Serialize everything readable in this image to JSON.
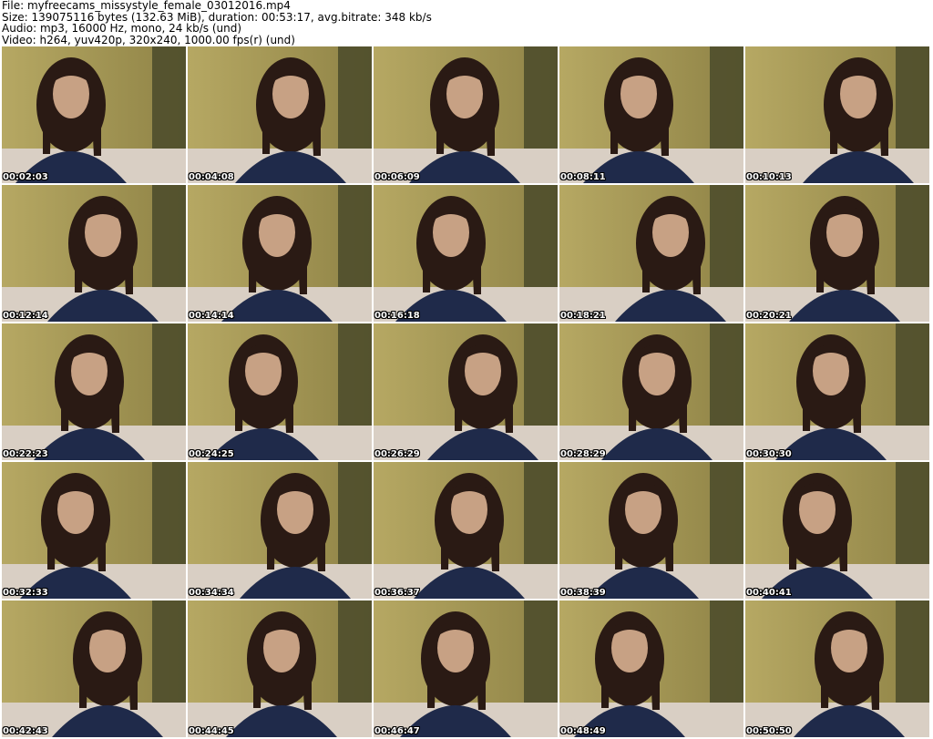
{
  "header": {
    "file_line": "File: myfreecams_missystyle_female_03012016.mp4",
    "size_line": "Size: 139075116 bytes (132.63 MiB), duration: 00:53:17, avg.bitrate: 348 kb/s",
    "audio_line": "Audio: mp3, 16000 Hz, mono, 24 kb/s (und)",
    "video_line": "Video: h264, yuv420p, 320x240, 1000.00 fps(r) (und)"
  },
  "colors": {
    "wall": "#b6a863",
    "wall_shadow": "#8f8346",
    "curtain": "#4a4a2a",
    "hoodie": "#1f2a4a",
    "hair": "#2a1a14",
    "skin": "#c7a184",
    "bed": "#d9cfc4"
  },
  "thumbnails": [
    "00:02:03",
    "00:04:08",
    "00:06:09",
    "00:08:11",
    "00:10:13",
    "00:12:14",
    "00:14:14",
    "00:16:18",
    "00:18:21",
    "00:20:21",
    "00:22:23",
    "00:24:25",
    "00:26:29",
    "00:28:29",
    "00:30:30",
    "00:32:33",
    "00:34:34",
    "00:36:37",
    "00:38:39",
    "00:40:41",
    "00:42:43",
    "00:44:45",
    "00:46:47",
    "00:48:49",
    "00:50:50"
  ]
}
